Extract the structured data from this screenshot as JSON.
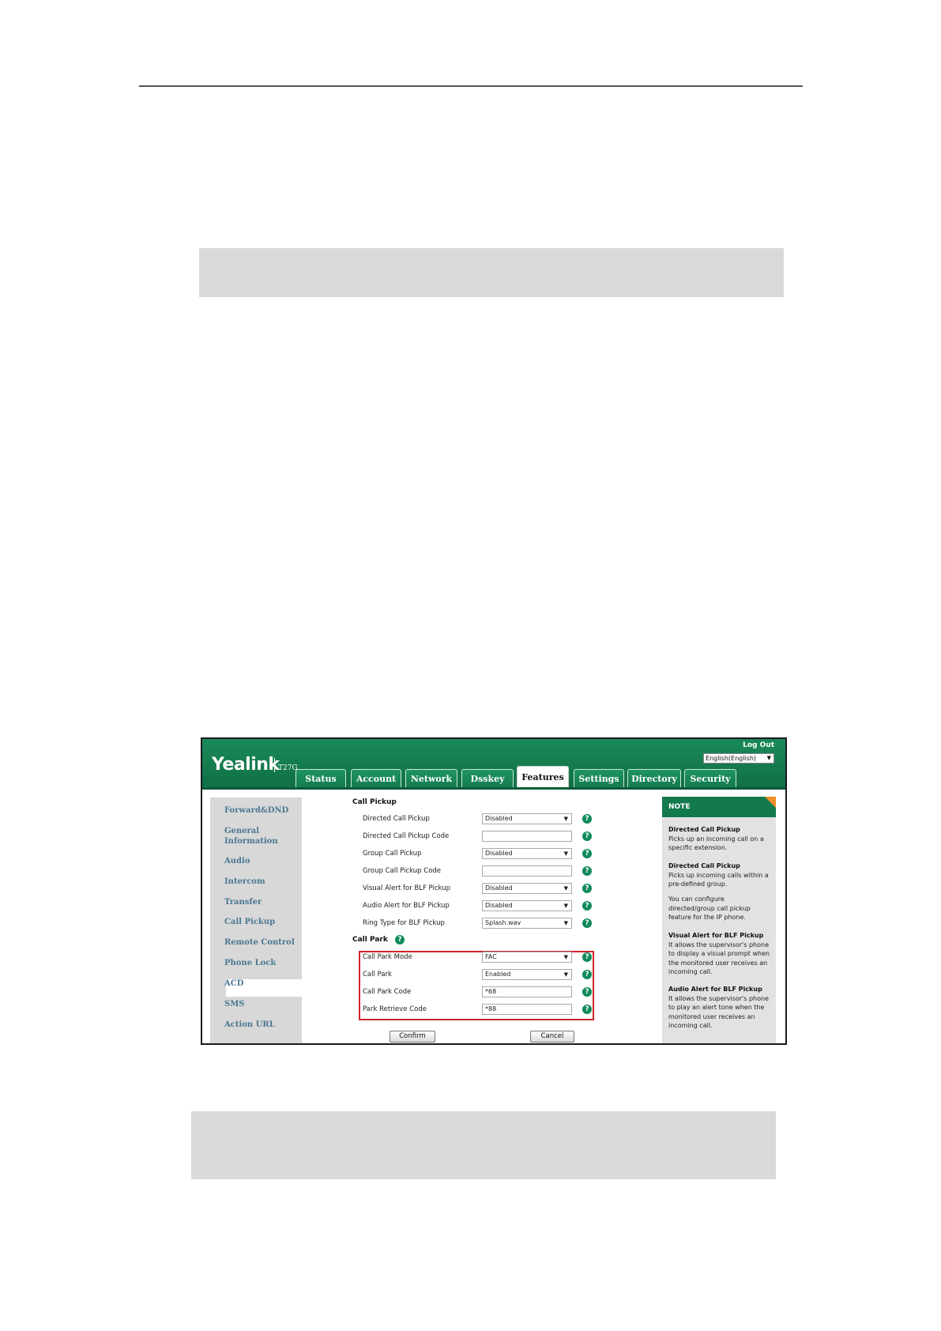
{
  "header": {
    "logo": "Yealink",
    "model": "T27G",
    "logout": "Log Out",
    "language": "English(English)"
  },
  "tabs": [
    "Status",
    "Account",
    "Network",
    "Dsskey",
    "Features",
    "Settings",
    "Directory",
    "Security"
  ],
  "active_tab": "Features",
  "sidebar": {
    "items": [
      "Forward&DND",
      "General\nInformation",
      "Audio",
      "Intercom",
      "Transfer",
      "Call Pickup",
      "Remote Control",
      "Phone Lock",
      "ACD",
      "SMS",
      "Action URL"
    ],
    "active": "Call Pickup"
  },
  "call_pickup": {
    "section": "Call Pickup",
    "rows": [
      {
        "label": "Directed Call Pickup",
        "value": "Disabled",
        "type": "select"
      },
      {
        "label": "Directed Call Pickup Code",
        "value": "",
        "type": "text"
      },
      {
        "label": "Group Call Pickup",
        "value": "Disabled",
        "type": "select"
      },
      {
        "label": "Group Call Pickup Code",
        "value": "",
        "type": "text"
      },
      {
        "label": "Visual Alert for BLF Pickup",
        "value": "Disabled",
        "type": "select"
      },
      {
        "label": "Audio Alert for BLF Pickup",
        "value": "Disabled",
        "type": "select"
      },
      {
        "label": "Ring Type for BLF Pickup",
        "value": "Splash.wav",
        "type": "select"
      }
    ]
  },
  "call_park": {
    "section": "Call Park",
    "rows": [
      {
        "label": "Call Park Mode",
        "value": "FAC",
        "type": "select"
      },
      {
        "label": "Call Park",
        "value": "Enabled",
        "type": "select"
      },
      {
        "label": "Call Park Code",
        "value": "*68",
        "type": "text"
      },
      {
        "label": "Park Retrieve Code",
        "value": "*88",
        "type": "text"
      }
    ]
  },
  "buttons": {
    "confirm": "Confirm",
    "cancel": "Cancel"
  },
  "note": {
    "title": "NOTE",
    "entries": [
      {
        "title": "Directed Call Pickup",
        "text": "Picks up an incoming call on a specific extension."
      },
      {
        "title": "Directed Call Pickup",
        "text": "Picks up incoming calls within a pre-defined group."
      },
      {
        "title": "",
        "text": "You can configure directed/group call pickup feature for the IP phone."
      },
      {
        "title": "Visual Alert for BLF Pickup",
        "text": "It allows the supervisor's phone to display a visual prompt when the monitored user receives an incoming call."
      },
      {
        "title": "Audio Alert for BLF Pickup",
        "text": "It allows the supervisor's phone to play an alert tone when the monitored user receives an incoming call."
      }
    ]
  },
  "colors": {
    "brand_green": "#137a4e",
    "highlight_red": "#d0252a",
    "note_corner": "#f28c28"
  }
}
